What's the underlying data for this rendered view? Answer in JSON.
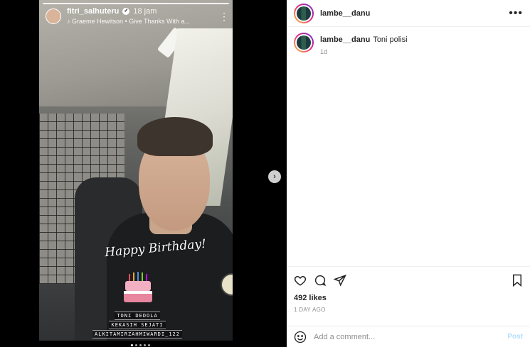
{
  "story": {
    "username": "fitri_salhuteru",
    "time": "18 jam",
    "music": "Graeme Hewitson • Give Thanks With a...",
    "sticker_text": "Happy Birthday!",
    "caption_lines": [
      "TONI DEDOLA",
      "KEKASIH SEJATI",
      "ALKITAMIRZAHMIWARDI_122"
    ]
  },
  "post": {
    "username": "lambe__danu",
    "caption_user": "lambe__danu",
    "caption_text": "Toni polisi",
    "caption_time": "1d",
    "likes": "492 likes",
    "date": "1 DAY AGO"
  },
  "comment_box": {
    "placeholder": "Add a comment...",
    "post_label": "Post"
  },
  "icons": {
    "like": "heart-icon",
    "comment": "comment-icon",
    "share": "share-icon",
    "save": "bookmark-icon",
    "more": "more-icon",
    "next": "chevron-right-icon",
    "emoji": "emoji-icon"
  }
}
